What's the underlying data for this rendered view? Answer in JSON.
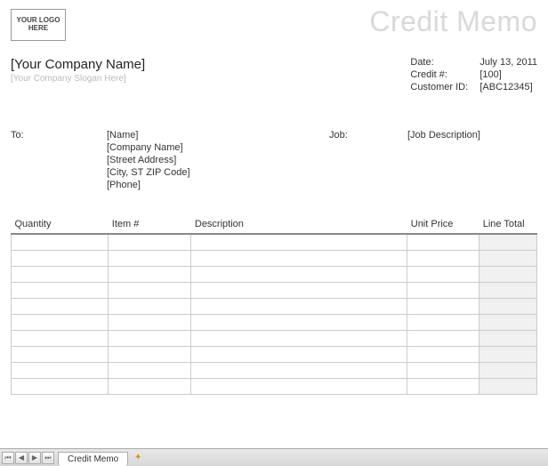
{
  "logo_text": "YOUR LOGO HERE",
  "title": "Credit Memo",
  "company": {
    "name": "[Your Company Name]",
    "slogan": "[Your Company Slogan Here]"
  },
  "meta": {
    "date_label": "Date:",
    "date_value": "July 13, 2011",
    "credit_label": "Credit #:",
    "credit_value": "[100]",
    "customer_label": "Customer ID:",
    "customer_value": "[ABC12345]"
  },
  "to": {
    "label": "To:",
    "name": "[Name]",
    "company": "[Company Name]",
    "street": "[Street Address]",
    "citystate": "[City, ST  ZIP Code]",
    "phone": "[Phone]"
  },
  "job": {
    "label": "Job:",
    "value": "[Job Description]"
  },
  "columns": {
    "qty": "Quantity",
    "item": "Item #",
    "desc": "Description",
    "price": "Unit Price",
    "total": "Line Total"
  },
  "tab_name": "Credit Memo"
}
